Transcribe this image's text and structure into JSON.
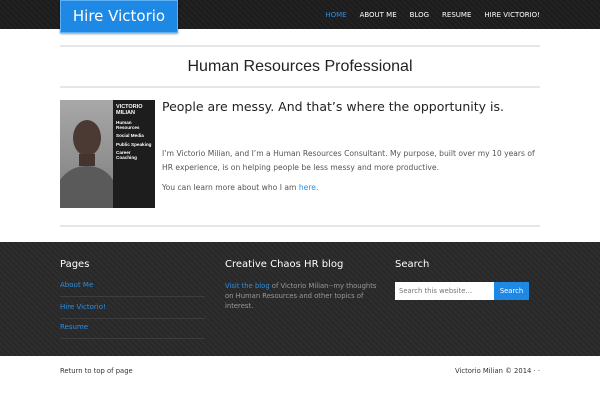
{
  "header": {
    "logo": "Hire Victorio",
    "nav": [
      {
        "label": "HOME",
        "active": true
      },
      {
        "label": "ABOUT ME",
        "active": false
      },
      {
        "label": "BLOG",
        "active": false
      },
      {
        "label": "RESUME",
        "active": false
      },
      {
        "label": "HIRE VICTORIO!",
        "active": false
      }
    ]
  },
  "main": {
    "title": "Human Resources Professional",
    "profile_card": {
      "name": "VICTORIO MILIAN",
      "items": [
        "Human Resources",
        "Social Media",
        "Public Speaking",
        "Career Coaching"
      ]
    },
    "headline": "People are messy. And that’s where the opportunity is.",
    "intro": "I’m Victorio Milian, and I’m a Human Resources Consultant. My purpose, built over my 10 years of HR experience, is on helping people be less messy and more productive.",
    "learn_prefix": "You can learn more about who I am ",
    "learn_link": "here",
    "learn_suffix": "."
  },
  "footer_widgets": {
    "pages": {
      "title": "Pages",
      "links": [
        "About Me",
        "Hire Victorio!",
        "Resume"
      ]
    },
    "blog": {
      "title": "Creative Chaos HR blog",
      "link": "Visit the blog",
      "text": " of Victorio Milian--my thoughts on Human Resources and other topics of interest."
    },
    "search": {
      "title": "Search",
      "placeholder": "Search this website…",
      "button": "Search"
    }
  },
  "site_footer": {
    "left": "Return to top of page",
    "right": "Victorio Milian © 2014 · ·"
  },
  "colors": {
    "accent": "#1e88e5",
    "link": "#2a8fe6",
    "topbar": "#1f1f1f",
    "footer_bg": "#2b2b2b"
  }
}
